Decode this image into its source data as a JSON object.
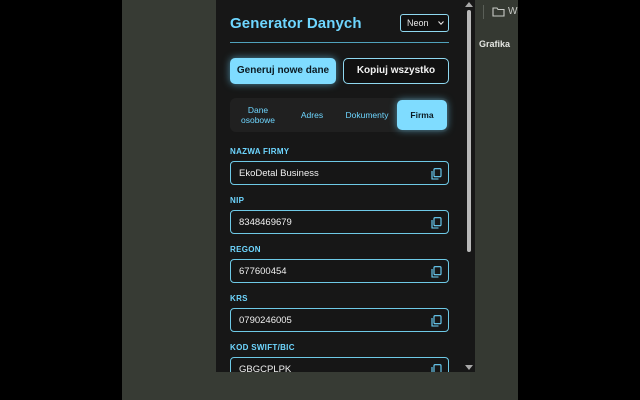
{
  "app": {
    "title": "Generator Danych",
    "theme": "Neon"
  },
  "actions": {
    "generate": "Generuj nowe dane",
    "copy_all": "Kopiuj wszystko"
  },
  "tabs": [
    {
      "label": "Dane osobowe",
      "active": false
    },
    {
      "label": "Adres",
      "active": false
    },
    {
      "label": "Dokumenty",
      "active": false
    },
    {
      "label": "Firma",
      "active": true
    }
  ],
  "fields": [
    {
      "label": "NAZWA FIRMY",
      "value": "EkoDetal Business"
    },
    {
      "label": "NIP",
      "value": "8348469679"
    },
    {
      "label": "REGON",
      "value": "677600454"
    },
    {
      "label": "KRS",
      "value": "0790246005"
    },
    {
      "label": "KOD SWIFT/BIC",
      "value": "GBGCPLPK"
    }
  ],
  "browser": {
    "bookmark_folder": "Ws",
    "side_label": "Grafika"
  },
  "icons": {
    "copy": "copy-icon",
    "chevron": "chevron-down-icon",
    "folder": "folder-icon"
  },
  "colors": {
    "accent": "#6ed6ff",
    "panel_bg": "#171717",
    "page_bg": "#373b34"
  }
}
